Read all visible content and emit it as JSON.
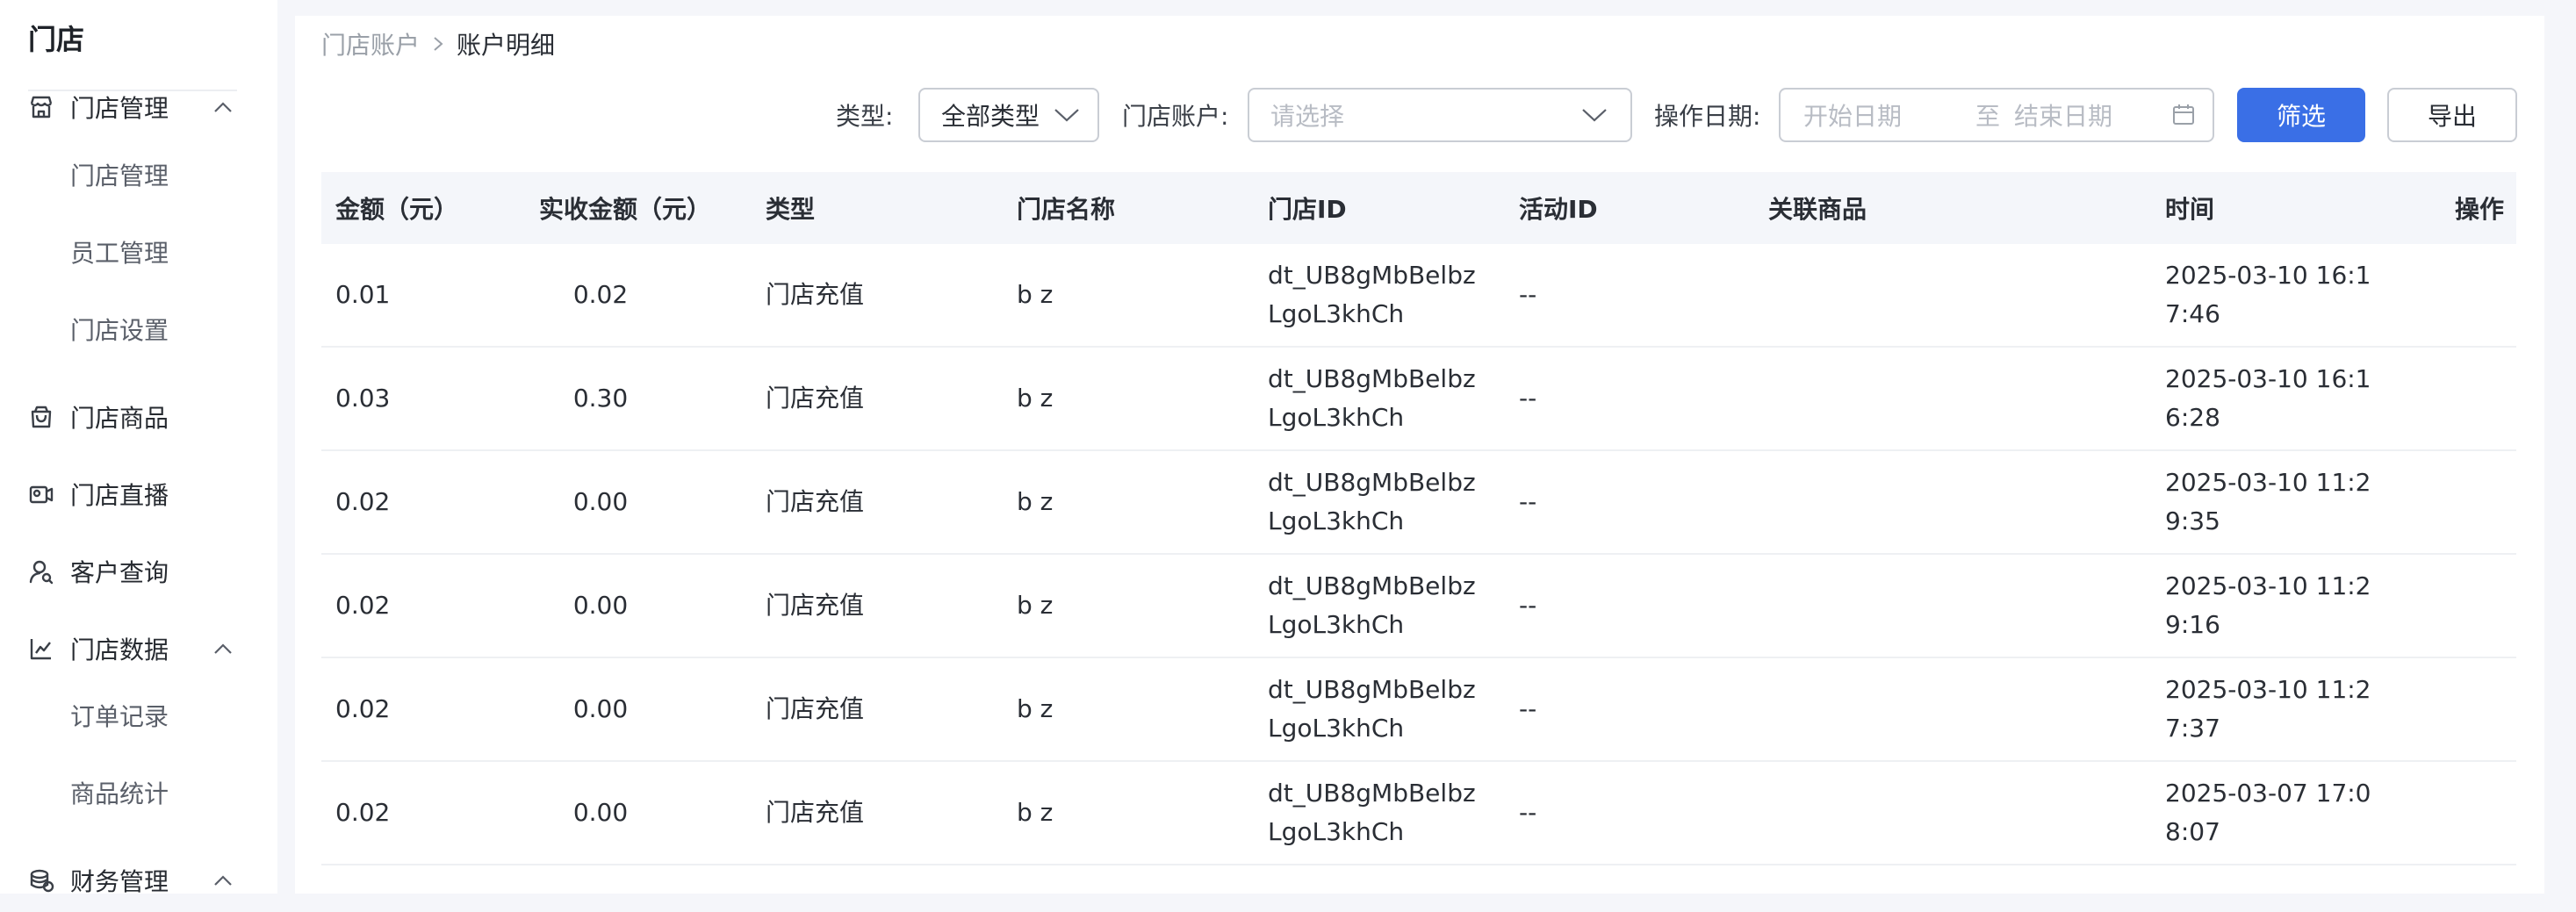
{
  "sidebar": {
    "title": "门店",
    "menu": [
      {
        "label": "门店管理",
        "icon": "store-icon",
        "expanded": true
      },
      {
        "label": "门店管理"
      },
      {
        "label": "员工管理"
      },
      {
        "label": "门店设置"
      },
      {
        "label": "门店商品",
        "icon": "shopping-bag-icon"
      },
      {
        "label": "门店直播",
        "icon": "live-camera-icon"
      },
      {
        "label": "客户查询",
        "icon": "user-search-icon"
      },
      {
        "label": "门店数据",
        "icon": "data-chart-icon",
        "expanded": true
      },
      {
        "label": "订单记录"
      },
      {
        "label": "商品统计"
      },
      {
        "label": "财务管理",
        "icon": "finance-coins-icon",
        "expanded": true
      }
    ]
  },
  "breadcrumb": {
    "parent": "门店账户",
    "current": "账户明细"
  },
  "filters": {
    "type_label": "类型:",
    "type_value": "全部类型",
    "account_label": "门店账户:",
    "account_placeholder": "请选择",
    "date_label": "操作日期:",
    "date_start_placeholder": "开始日期",
    "date_separator": "至",
    "date_end_placeholder": "结束日期",
    "filter_button": "筛选",
    "export_button": "导出"
  },
  "table": {
    "columns": [
      "金额（元）",
      "实收金额（元）",
      "类型",
      "门店名称",
      "门店ID",
      "活动ID",
      "关联商品",
      "时间",
      "操作"
    ],
    "rows": [
      {
        "amount": "0.01",
        "received": "0.02",
        "type": "门店充值",
        "store_name": "b z",
        "store_id": "dt_UB8gMbBelbzLgoL3khCh",
        "activity_id": "--",
        "product": "",
        "time": "2025-03-10 16:17:46",
        "action": ""
      },
      {
        "amount": "0.03",
        "received": "0.30",
        "type": "门店充值",
        "store_name": "b z",
        "store_id": "dt_UB8gMbBelbzLgoL3khCh",
        "activity_id": "--",
        "product": "",
        "time": "2025-03-10 16:16:28",
        "action": ""
      },
      {
        "amount": "0.02",
        "received": "0.00",
        "type": "门店充值",
        "store_name": "b z",
        "store_id": "dt_UB8gMbBelbzLgoL3khCh",
        "activity_id": "--",
        "product": "",
        "time": "2025-03-10 11:29:35",
        "action": ""
      },
      {
        "amount": "0.02",
        "received": "0.00",
        "type": "门店充值",
        "store_name": "b z",
        "store_id": "dt_UB8gMbBelbzLgoL3khCh",
        "activity_id": "--",
        "product": "",
        "time": "2025-03-10 11:29:16",
        "action": ""
      },
      {
        "amount": "0.02",
        "received": "0.00",
        "type": "门店充值",
        "store_name": "b z",
        "store_id": "dt_UB8gMbBelbzLgoL3khCh",
        "activity_id": "--",
        "product": "",
        "time": "2025-03-10 11:27:37",
        "action": ""
      },
      {
        "amount": "0.02",
        "received": "0.00",
        "type": "门店充值",
        "store_name": "b z",
        "store_id": "dt_UB8gMbBelbzLgoL3khCh",
        "activity_id": "--",
        "product": "",
        "time": "2025-03-07 17:08:07",
        "action": ""
      }
    ]
  }
}
